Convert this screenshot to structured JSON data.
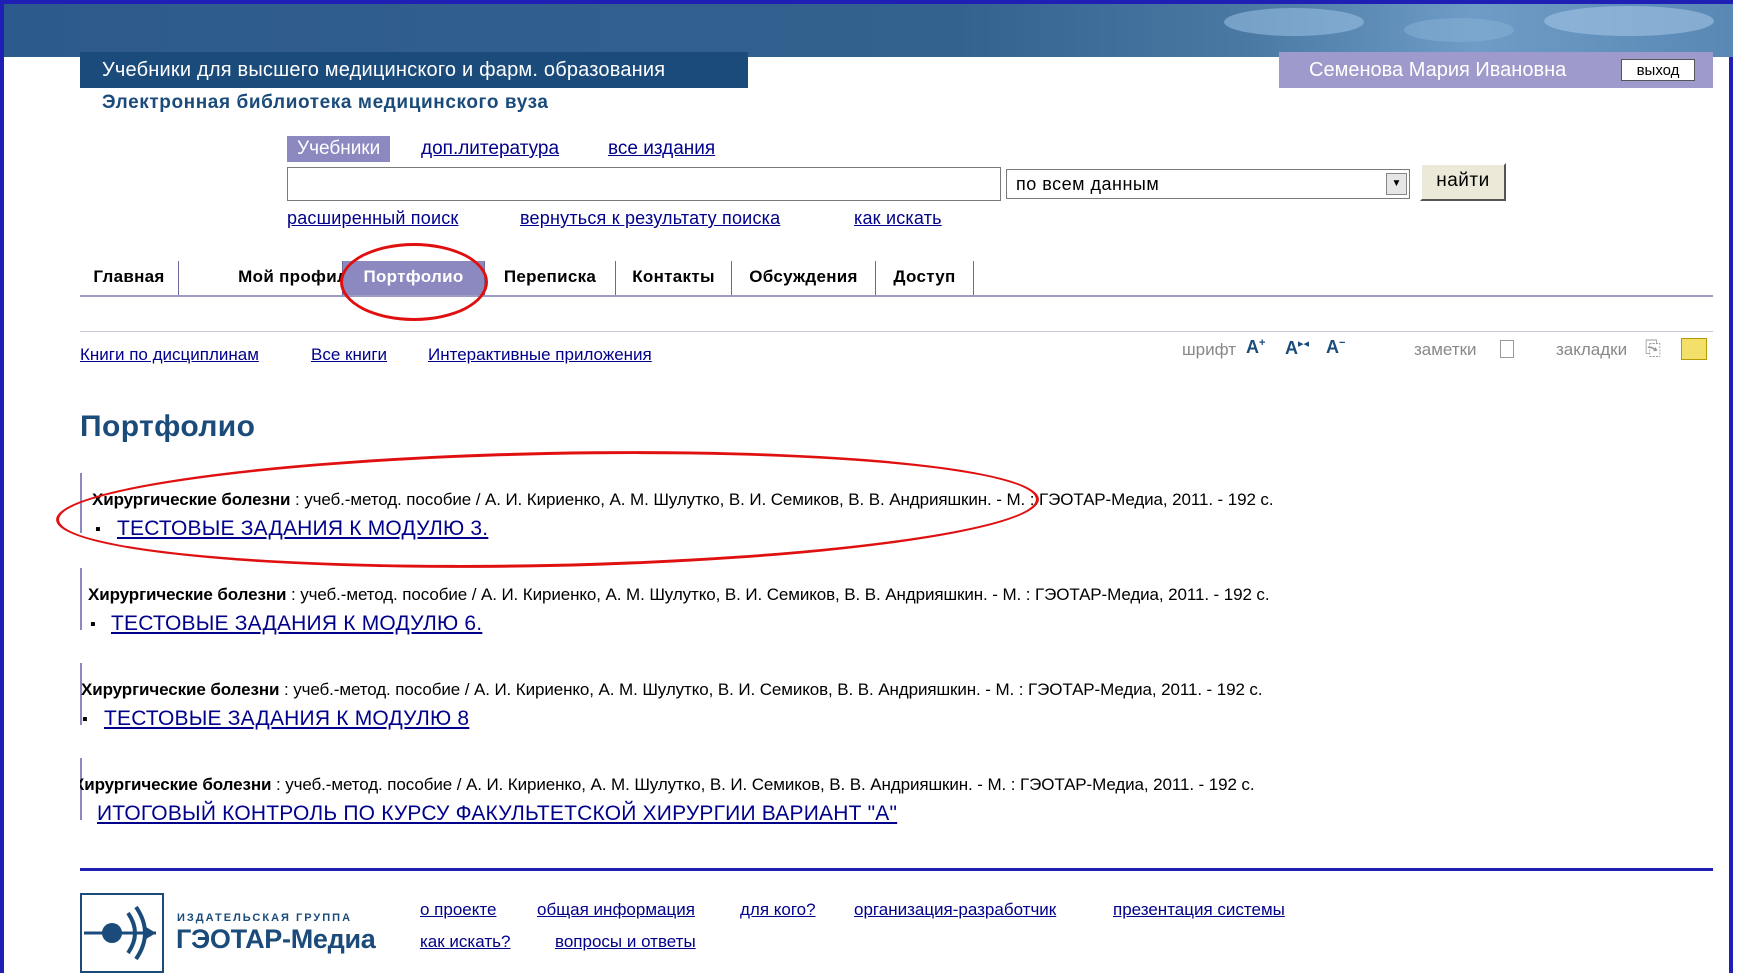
{
  "header": {
    "site_title": "Учебники для высшего медицинского и фарм. образования",
    "site_subtitle": "Электронная библиотека медицинского вуза",
    "user_name": "Семенова Мария Ивановна",
    "logout_label": "выход"
  },
  "search": {
    "tabs": [
      "Учебники",
      "доп.литература",
      "все издания"
    ],
    "input_value": "",
    "scope_selected": "по всем данным",
    "submit_label": "найти",
    "links": [
      "расширенный поиск",
      "вернуться к результату поиска",
      "как искать"
    ]
  },
  "nav": {
    "tabs": [
      "Главная",
      "Мой профиль",
      "Портфолио",
      "Переписка",
      "Контакты",
      "Обсуждения",
      "Доступ"
    ],
    "active_tab": "Портфолио"
  },
  "subnav": {
    "links": [
      "Книги по дисциплинам",
      "Все книги",
      "Интерактивные приложения"
    ],
    "font_label": "шрифт",
    "notes_label": "заметки",
    "bookmarks_label": "закладки"
  },
  "main": {
    "title": "Портфолио",
    "entries": [
      {
        "title": "Хирургические болезни",
        "rest": " : учеб.-метод. пособие / А. И. Кириенко, А. М. Шулутко, В. И. Семиков, В. В. Андрияшкин. - М. : ГЭОТАР-Медиа, 2011. - 192 с.",
        "link": "ТЕСТОВЫЕ ЗАДАНИЯ К МОДУЛЮ 3."
      },
      {
        "title": "Хирургические болезни",
        "rest": " : учеб.-метод. пособие / А. И. Кириенко, А. М. Шулутко, В. И. Семиков, В. В. Андрияшкин. - М. : ГЭОТАР-Медиа, 2011. - 192 с.",
        "link": "ТЕСТОВЫЕ ЗАДАНИЯ К МОДУЛЮ 6."
      },
      {
        "title": "Хирургические болезни",
        "rest": " : учеб.-метод. пособие / А. И. Кириенко, А. М. Шулутко, В. И. Семиков, В. В. Андрияшкин. - М. : ГЭОТАР-Медиа, 2011. - 192 с.",
        "link": "ТЕСТОВЫЕ ЗАДАНИЯ К МОДУЛЮ 8"
      },
      {
        "title": "Хирургические болезни",
        "rest": " : учеб.-метод. пособие / А. И. Кириенко, А. М. Шулутко, В. И. Семиков, В. В. Андрияшкин. - М. : ГЭОТАР-Медиа, 2011. - 192 с.",
        "link": "ИТОГОВЫЙ КОНТРОЛЬ ПО КУРСУ ФАКУЛЬТЕТСКОЙ ХИРУРГИИ ВАРИАНТ \"А\""
      }
    ]
  },
  "footer": {
    "brand_small": "ИЗДАТЕЛЬСКАЯ ГРУППА",
    "brand_big": "ГЭОТАР-Медиа",
    "links_row1": [
      "о проекте",
      "общая информация",
      "для кого?",
      "организация-разработчик",
      "презентация системы"
    ],
    "links_row2": [
      "как искать?",
      "вопросы и ответы"
    ]
  },
  "colors": {
    "brand_blue": "#1a4b7a",
    "tab_active": "#8c89c0",
    "link": "#00008b",
    "annotation_red": "#e01010",
    "frame": "#1f1fb5"
  }
}
